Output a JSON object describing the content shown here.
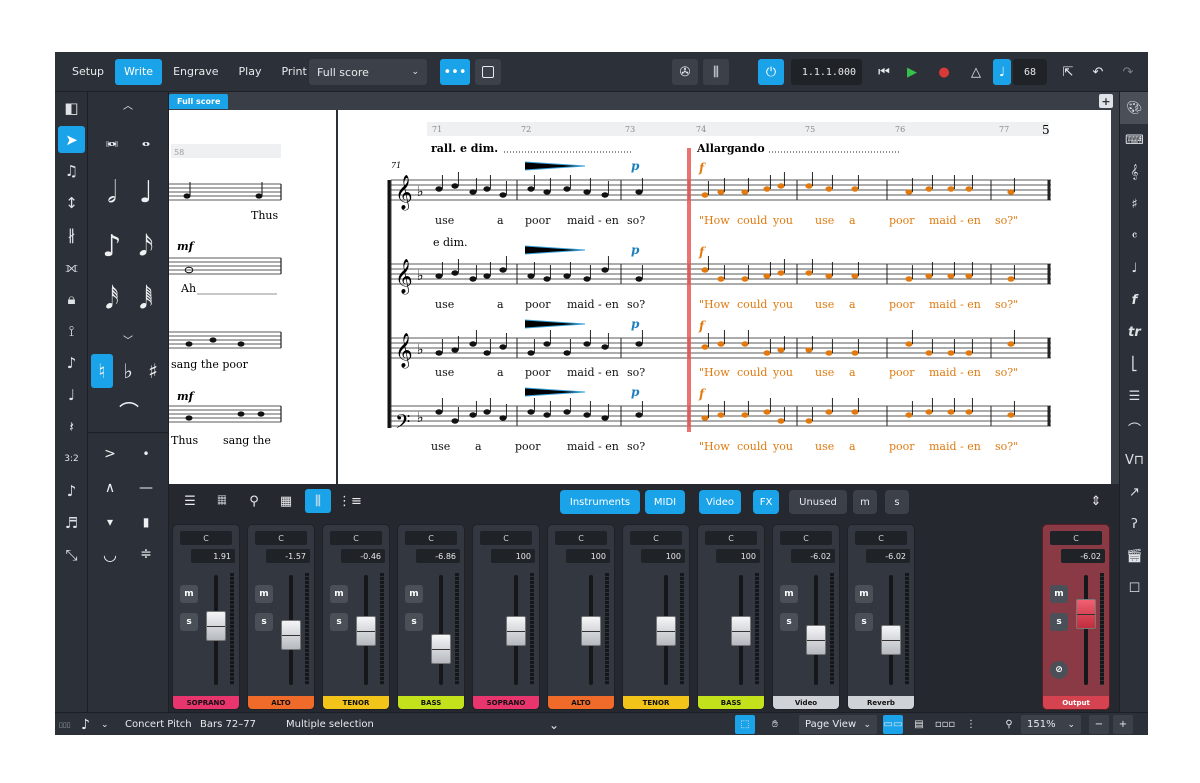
{
  "toolbar": {
    "modes": [
      "Setup",
      "Write",
      "Engrave",
      "Play",
      "Print"
    ],
    "active_mode": "Write",
    "layout_select": "Full score",
    "position_counter": "1.1.1.000",
    "tempo_value": "68"
  },
  "score": {
    "tab_label": "Full score",
    "left_bar_number": "58",
    "bar_numbers": [
      "71",
      "72",
      "73",
      "74",
      "75",
      "76",
      "77"
    ],
    "system_number": "71",
    "page_number": "5",
    "tempo_text_1": "rall. e dim.",
    "tempo_text_2": "Allargando",
    "left_lyrics": [
      "Thus",
      "Ah",
      "sang the poor",
      "Thus",
      "sang the"
    ],
    "left_dynamics": [
      "mf",
      "mf"
    ],
    "edim_text": "e dim.",
    "lyrics_row1": [
      "use",
      "a",
      "poor",
      "maid - en",
      "so?"
    ],
    "lyrics_row2": [
      "use",
      "a",
      "poor",
      "maid - en",
      "so?"
    ],
    "lyrics_row3": [
      "use",
      "a",
      "poor",
      "maid - en",
      "so?"
    ],
    "lyrics_row4": [
      "use",
      "a",
      "poor",
      "maid - en",
      "so?"
    ],
    "sel_lyrics_row1": [
      "\"How",
      "could",
      "you",
      "use",
      "a",
      "poor",
      "maid - en",
      "so?\""
    ],
    "sel_lyrics_row2": [
      "\"How",
      "could",
      "you",
      "use",
      "a",
      "poor",
      "maid - en",
      "so?\""
    ],
    "sel_lyrics_row3": [
      "\"How",
      "could",
      "you",
      "use",
      "a",
      "poor",
      "maid - en",
      "so?\""
    ],
    "sel_lyrics_row4": [
      "\"How",
      "could",
      "you",
      "use",
      "a",
      "poor",
      "maid - en",
      "so?\""
    ],
    "dyn_p": "p",
    "dyn_f": "f"
  },
  "mixer": {
    "filters": [
      "Instruments",
      "MIDI",
      "Video",
      "FX",
      "Unused"
    ],
    "mute_label": "m",
    "solo_label": "s",
    "channels": [
      {
        "pan": "C",
        "vol": "1.91",
        "name": "SOPRANO",
        "color": "#e8356e",
        "ms": true,
        "fader": 0.6
      },
      {
        "pan": "C",
        "vol": "-1.57",
        "name": "ALTO",
        "color": "#f06a2a",
        "ms": true,
        "fader": 0.5
      },
      {
        "pan": "C",
        "vol": "-0.46",
        "name": "TENOR",
        "color": "#f2c318",
        "ms": true,
        "fader": 0.55
      },
      {
        "pan": "C",
        "vol": "-6.86",
        "name": "BASS",
        "color": "#c4e21c",
        "ms": true,
        "fader": 0.35
      },
      {
        "pan": "C",
        "vol": "100",
        "name": "SOPRANO",
        "color": "#e8356e",
        "ms": false,
        "fader": 0.55
      },
      {
        "pan": "C",
        "vol": "100",
        "name": "ALTO",
        "color": "#f06a2a",
        "ms": false,
        "fader": 0.55
      },
      {
        "pan": "C",
        "vol": "100",
        "name": "TENOR",
        "color": "#f2c318",
        "ms": false,
        "fader": 0.55
      },
      {
        "pan": "C",
        "vol": "100",
        "name": "BASS",
        "color": "#c4e21c",
        "ms": false,
        "fader": 0.55
      },
      {
        "pan": "C",
        "vol": "-6.02",
        "name": "Video",
        "color": "#cfd2d6",
        "ms": true,
        "fader": 0.45
      },
      {
        "pan": "C",
        "vol": "-6.02",
        "name": "Reverb",
        "color": "#cfd2d6",
        "ms": true,
        "fader": 0.45
      }
    ],
    "output": {
      "pan": "C",
      "vol": "-6.02",
      "name": "Output"
    }
  },
  "statusbar": {
    "concert_pitch": "Concert Pitch",
    "bars": "Bars 72–77",
    "selection": "Multiple selection",
    "view": "Page View",
    "zoom": "151%"
  },
  "colors": {
    "accent": "#1aa3e8",
    "selection": "#e8891c",
    "playhead": "#e85a5a"
  }
}
